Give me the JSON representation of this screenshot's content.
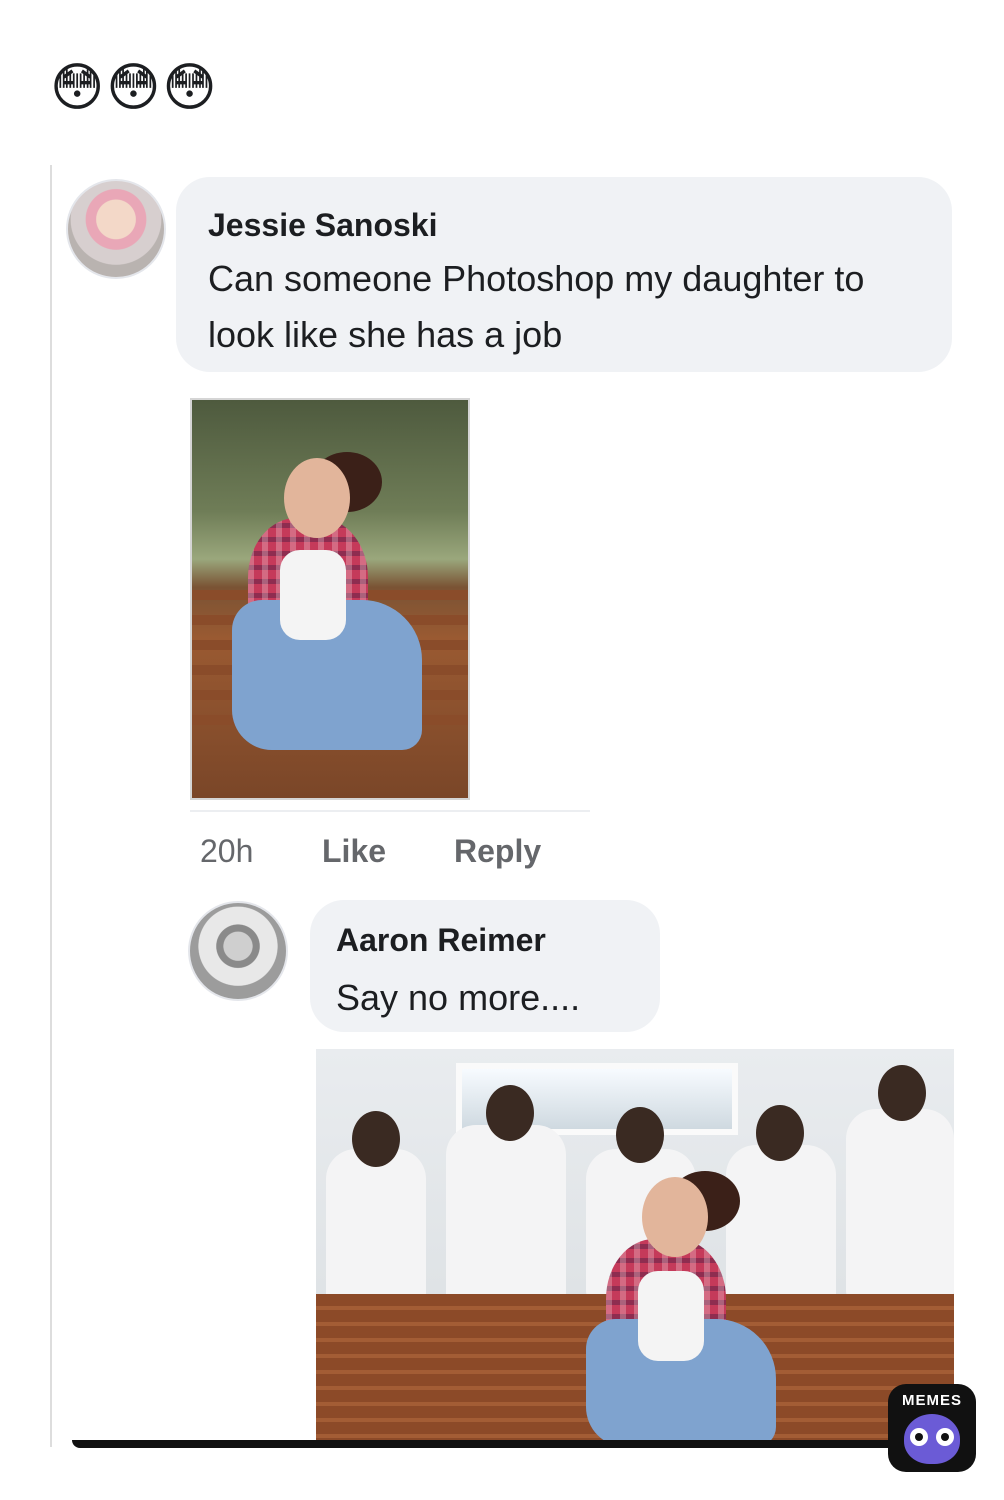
{
  "caption": {
    "emoji": "😳😳😳"
  },
  "comment1": {
    "author": "Jessie Sanoski",
    "text": "Can someone Photoshop my daughter to look like she has a job",
    "time": "20h",
    "like_label": "Like",
    "reply_label": "Reply"
  },
  "comment2": {
    "author": "Aaron Reimer",
    "text": "Say no more...."
  },
  "watermark": {
    "label": "MEMES",
    "icon": "owl-icon"
  }
}
